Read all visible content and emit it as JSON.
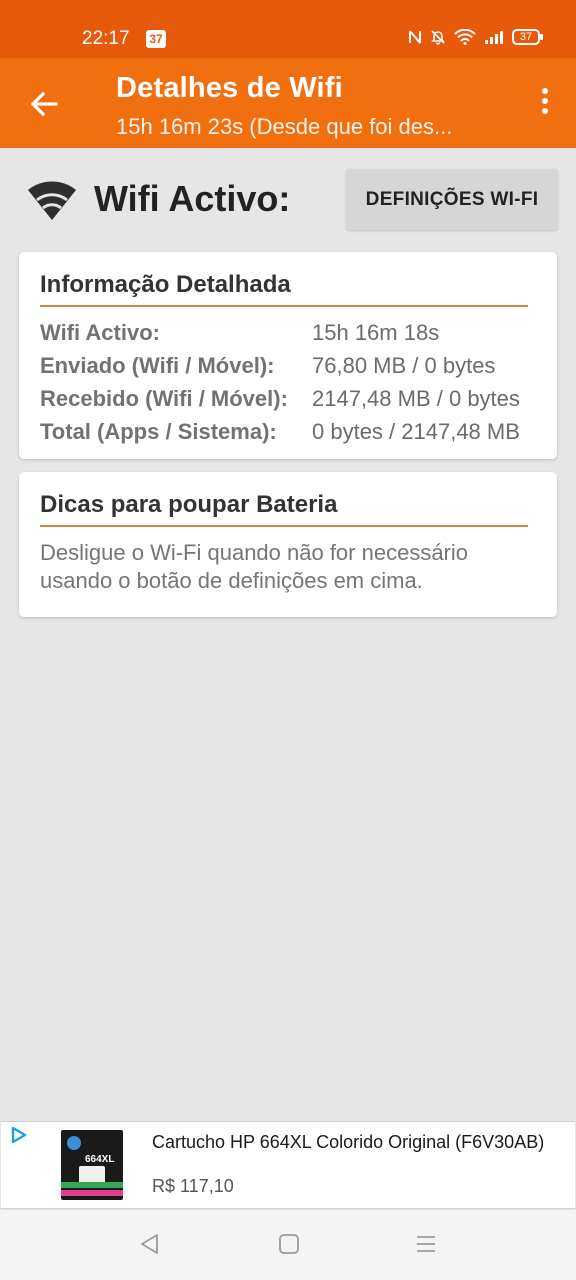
{
  "status_bar": {
    "time": "22:17",
    "notification_badge": "37",
    "battery_level": "37",
    "icons": [
      "nfc-icon",
      "bell-muted-icon",
      "wifi-signal-icon",
      "cellular-signal-icon",
      "battery-icon"
    ]
  },
  "app_bar": {
    "title": "Detalhes de Wifi",
    "subtitle": "15h 16m 23s (Desde que foi des..."
  },
  "wifi_status": {
    "label": "Wifi Activo:",
    "settings_button": "DEFINIÇÕES WI-FI"
  },
  "detailed_info": {
    "title": "Informação Detalhada",
    "rows": [
      {
        "key": "Wifi Activo:",
        "value": "15h 16m 18s"
      },
      {
        "key": "Enviado (Wifi / Móvel):",
        "value": "76,80 MB / 0 bytes"
      },
      {
        "key": "Recebido (Wifi / Móvel):",
        "value": "2147,48 MB / 0 bytes"
      },
      {
        "key": "Total (Apps / Sistema):",
        "value": "0 bytes / 2147,48 MB"
      }
    ]
  },
  "battery_tips": {
    "title": "Dicas para poupar Bateria",
    "text": "Desligue o Wi-Fi quando não for necessário usando o botão de definições em cima."
  },
  "ad": {
    "title": "Cartucho HP 664XL Colorido Original (F6V30AB)",
    "price": "R$ 117,10",
    "product_model_label": "664XL"
  },
  "colors": {
    "status_bar": "#e85a0b",
    "app_bar": "#f26f0f",
    "accent_rule": "#d28a40",
    "background": "#e6e6e6"
  }
}
